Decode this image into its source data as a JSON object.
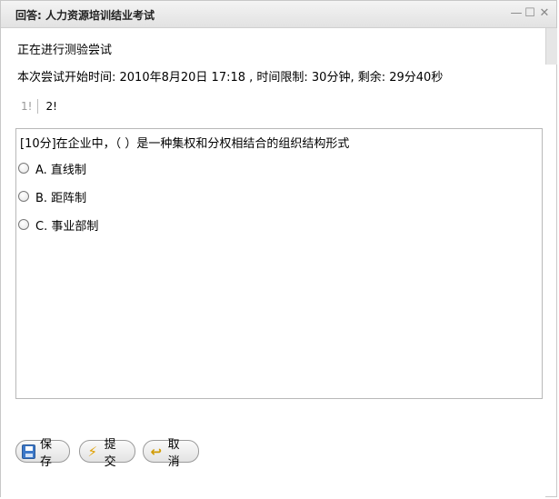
{
  "window": {
    "title": "回答: 人力资源培训结业考试",
    "controls": {
      "minimize_glyph": "—",
      "maximize_glyph": "☐",
      "close_glyph": "✕"
    }
  },
  "quiz": {
    "status": "正在进行测验尝试",
    "attempt_info": "本次尝试开始时间: 2010年8月20日 17:18 , 时间限制: 30分钟, 剩余: 29分40秒",
    "pages": [
      {
        "label": "1!",
        "current": false
      },
      {
        "label": "2!",
        "current": true
      }
    ],
    "question": {
      "text": "[10分]在企业中，（   ）是一种集权和分权相结合的组织结构形式",
      "options": [
        {
          "label": "A. 直线制",
          "selected": false
        },
        {
          "label": "B. 距阵制",
          "selected": false
        },
        {
          "label": "C. 事业部制",
          "selected": false
        }
      ]
    }
  },
  "buttons": {
    "save": {
      "label": "保存",
      "icon": "floppy-disk-icon"
    },
    "submit": {
      "label": "提交",
      "icon": "lightning-bolt-icon"
    },
    "cancel": {
      "label": "取消",
      "icon": "undo-arrow-icon"
    }
  }
}
